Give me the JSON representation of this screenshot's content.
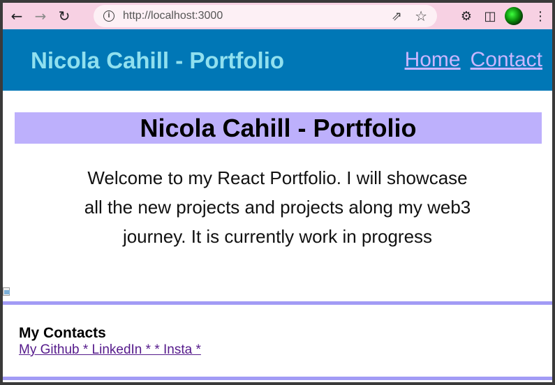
{
  "browser": {
    "url": "http://localhost:3000"
  },
  "header": {
    "site_title": "Nicola Cahill - Portfolio",
    "nav": [
      {
        "label": "Home"
      },
      {
        "label": "Contact"
      }
    ]
  },
  "hero": {
    "title": "Nicola Cahill - Portfolio",
    "intro_lines": [
      "Welcome to my React Portfolio. I will showcase",
      "all the new projects and projects along my web3",
      "journey. It is currently work in progress"
    ]
  },
  "footer": {
    "title": "My Contacts",
    "links_text": "My Github * LinkedIn * * Insta *"
  },
  "colors": {
    "chrome_bg": "#f7d1e3",
    "header_bg": "#0077b6",
    "header_title": "#90e0ef",
    "nav_link": "#c9b6ff",
    "hero_bg": "#bdb0fc",
    "divider": "#a29bf5",
    "link_visited": "#551a8b"
  },
  "icons": {
    "back": "arrow-left-icon",
    "forward": "arrow-right-icon",
    "reload": "reload-icon",
    "info": "info-icon",
    "share": "share-icon",
    "bookmark": "star-icon",
    "extensions": "puzzle-icon",
    "side_panel": "side-panel-icon",
    "profile": "avatar",
    "menu": "kebab-menu-icon"
  }
}
